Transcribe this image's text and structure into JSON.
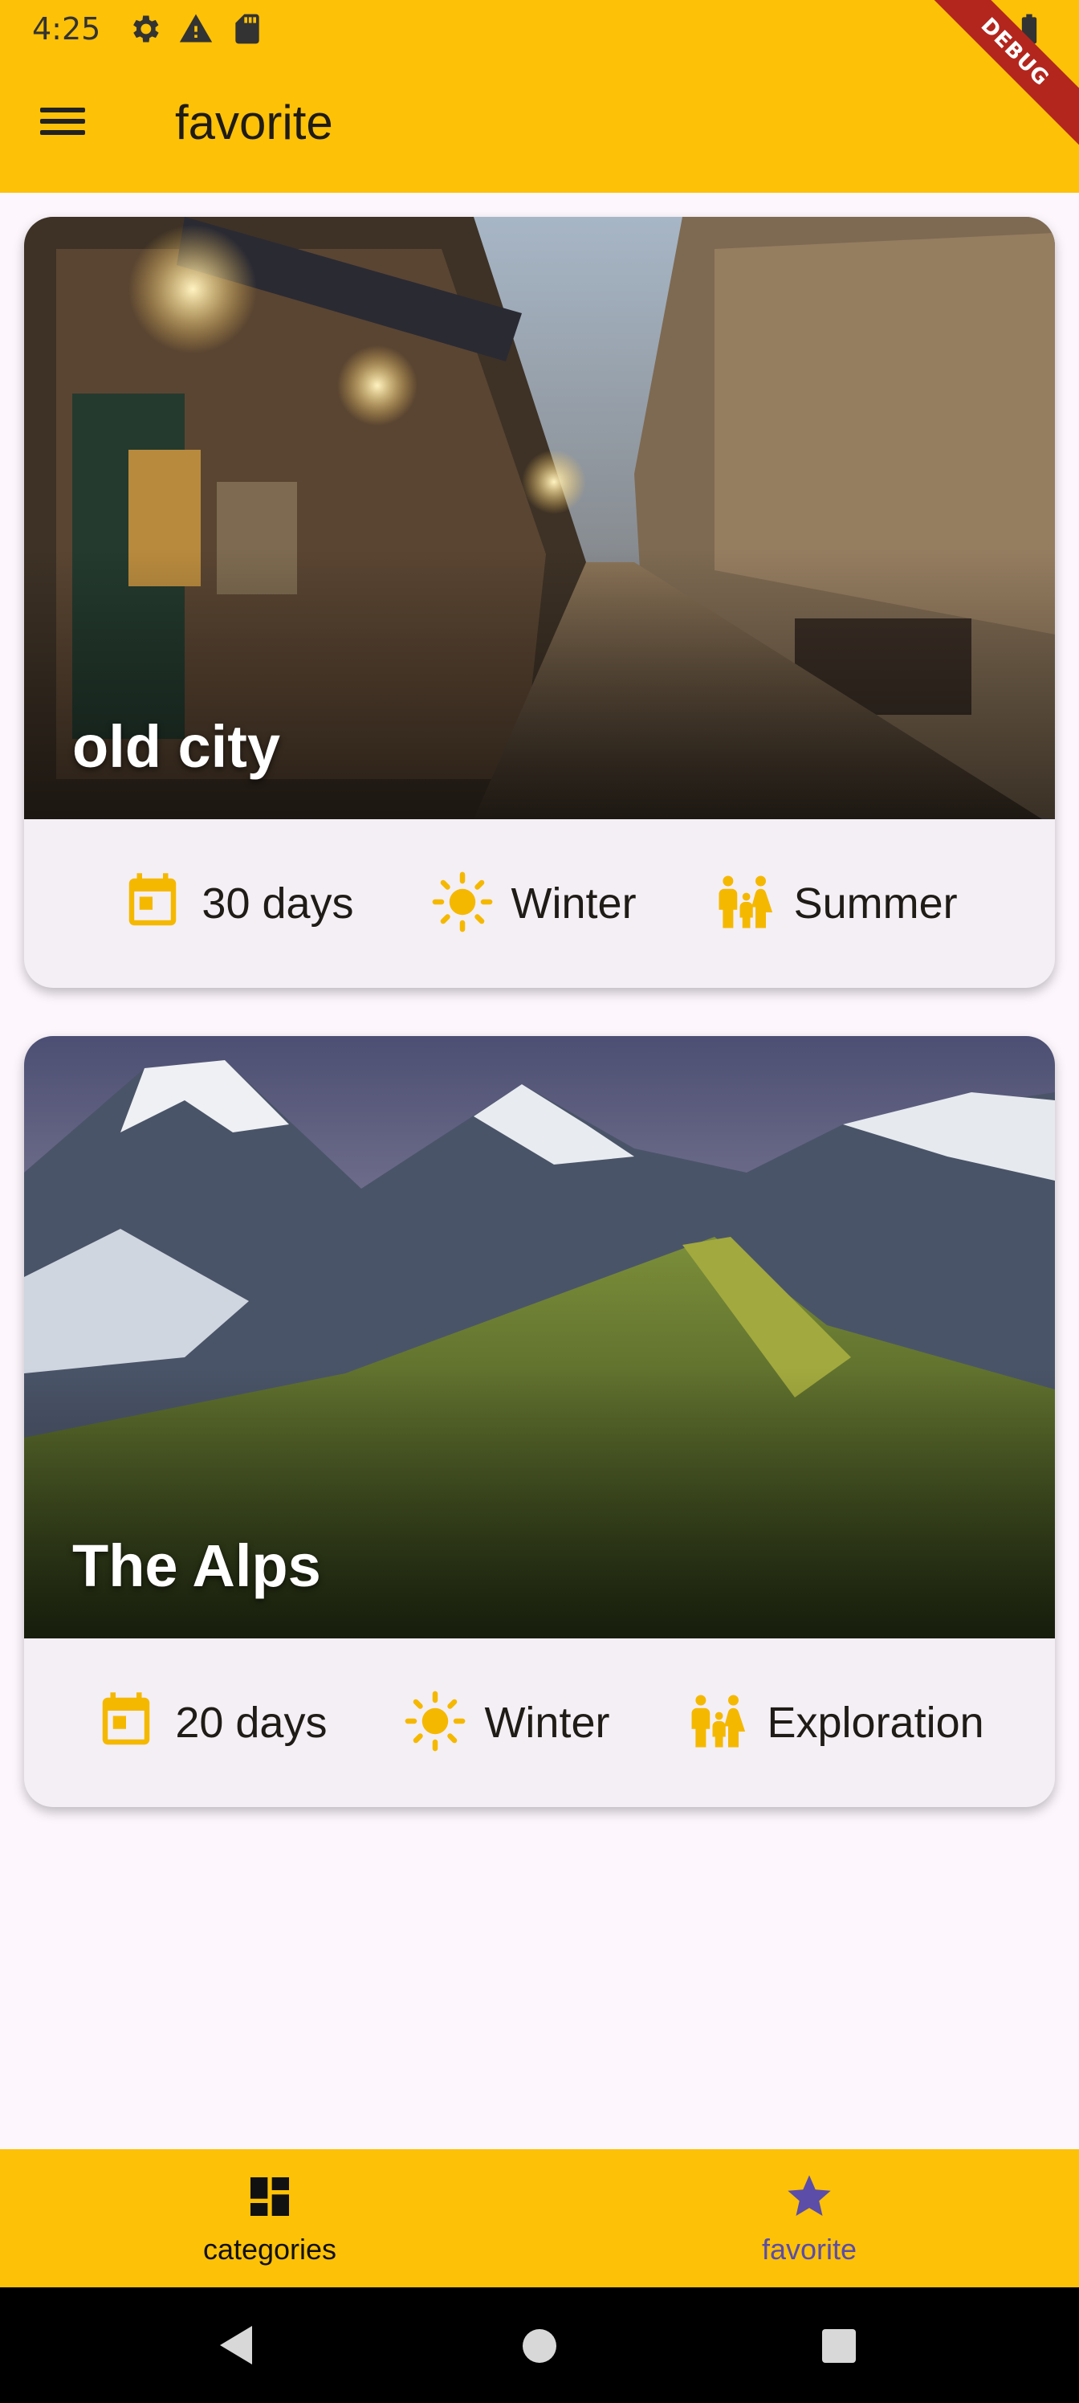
{
  "status_bar": {
    "time": "4:25",
    "left_icons": [
      "gear-icon",
      "warning-icon",
      "sd-card-icon"
    ],
    "right_icons": [
      "wifi-icon",
      "battery-icon"
    ],
    "debug_label": "DEBUG"
  },
  "app_bar": {
    "title": "favorite",
    "menu_icon": "menu-icon"
  },
  "cards": [
    {
      "title": "old city",
      "image": "old-city-street-photo",
      "duration": "30 days",
      "season": "Winter",
      "trip_type": "Summer"
    },
    {
      "title": "The Alps",
      "image": "alps-mountains-photo",
      "duration": "20 days",
      "season": "Winter",
      "trip_type": "Exploration"
    }
  ],
  "bottom_nav": {
    "items": [
      {
        "label": "categories",
        "icon": "dashboard-icon",
        "active": false
      },
      {
        "label": "favorite",
        "icon": "star-icon",
        "active": true
      }
    ]
  },
  "colors": {
    "primary": "#fdc107",
    "icon_accent": "#f5b800",
    "active_nav": "#5b4da8",
    "background": "#fdf7fd",
    "card": "#f4eff4"
  }
}
